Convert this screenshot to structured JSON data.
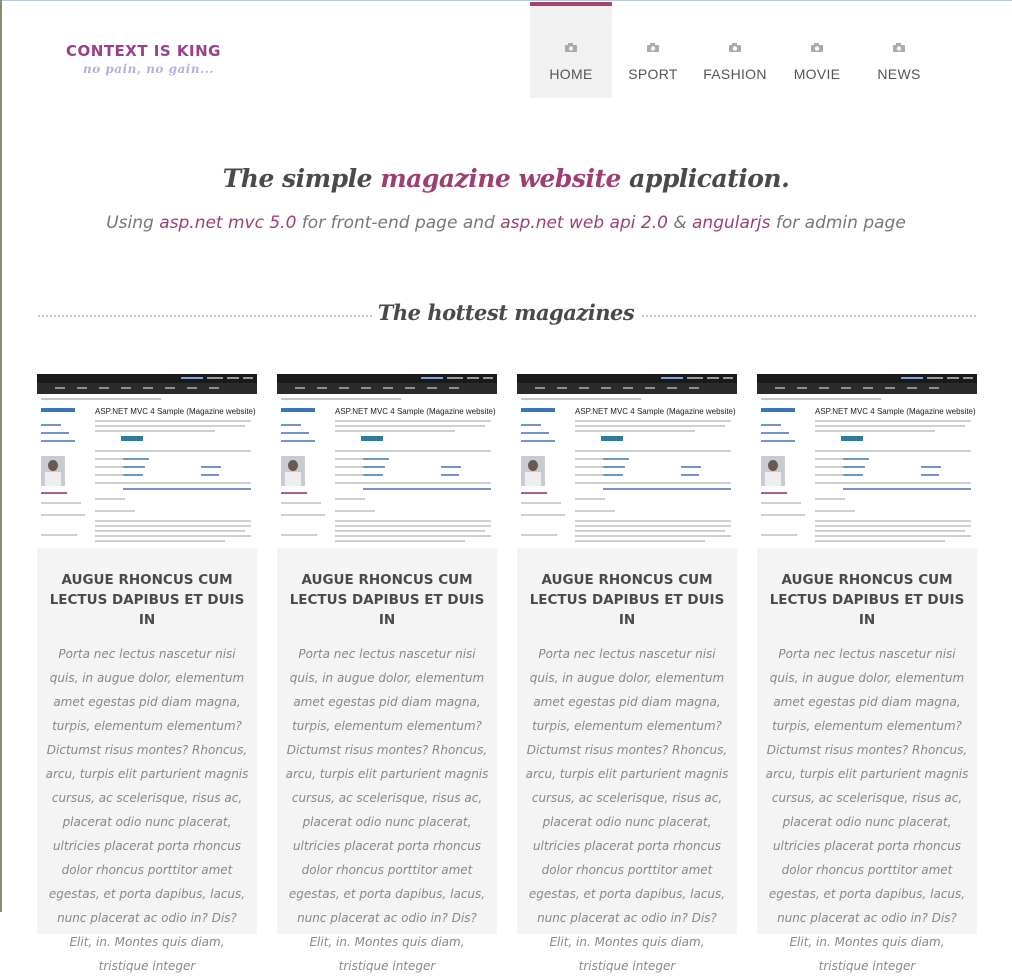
{
  "logo": {
    "title": "CONTEXT IS KING",
    "tagline": "no pain, no gain..."
  },
  "nav": {
    "items": [
      {
        "label": "HOME",
        "icon": "camera-icon",
        "active": true
      },
      {
        "label": "SPORT",
        "icon": "camera-icon",
        "active": false
      },
      {
        "label": "FASHION",
        "icon": "camera-icon",
        "active": false
      },
      {
        "label": "MOVIE",
        "icon": "camera-icon",
        "active": false
      },
      {
        "label": "NEWS",
        "icon": "camera-icon",
        "active": false
      }
    ]
  },
  "hero": {
    "title_pre": "The simple ",
    "title_accent": "magazine website",
    "title_post": " application.",
    "sub_1": "Using ",
    "sub_2": "asp.net mvc 5.0",
    "sub_3": " for front-end page and ",
    "sub_4": "asp.net web api 2.0",
    "sub_5": " & ",
    "sub_6": "angularjs",
    "sub_7": " for admin page"
  },
  "section": {
    "title": "The hottest magazines"
  },
  "cards": [
    {
      "thumb_title": "ASP.NET MVC 4 Sample (Magazine website)",
      "title": "AUGUE RHONCUS CUM LECTUS DAPIBUS ET DUIS IN",
      "text": "Porta nec lectus nascetur nisi quis, in augue dolor, elementum amet egestas pid diam magna, turpis, elementum elementum? Dictumst risus montes? Rhoncus, arcu, turpis elit parturient magnis cursus, ac scelerisque, risus ac, placerat odio nunc placerat, ultricies placerat porta rhoncus dolor rhoncus porttitor amet egestas, et porta dapibus, lacus, nunc placerat ac odio in? Dis? Elit, in. Montes quis diam, tristique integer"
    },
    {
      "thumb_title": "ASP.NET MVC 4 Sample (Magazine website)",
      "title": "AUGUE RHONCUS CUM LECTUS DAPIBUS ET DUIS IN",
      "text": "Porta nec lectus nascetur nisi quis, in augue dolor, elementum amet egestas pid diam magna, turpis, elementum elementum? Dictumst risus montes? Rhoncus, arcu, turpis elit parturient magnis cursus, ac scelerisque, risus ac, placerat odio nunc placerat, ultricies placerat porta rhoncus dolor rhoncus porttitor amet egestas, et porta dapibus, lacus, nunc placerat ac odio in? Dis? Elit, in. Montes quis diam, tristique integer"
    },
    {
      "thumb_title": "ASP.NET MVC 4 Sample (Magazine website)",
      "title": "AUGUE RHONCUS CUM LECTUS DAPIBUS ET DUIS IN",
      "text": "Porta nec lectus nascetur nisi quis, in augue dolor, elementum amet egestas pid diam magna, turpis, elementum elementum? Dictumst risus montes? Rhoncus, arcu, turpis elit parturient magnis cursus, ac scelerisque, risus ac, placerat odio nunc placerat, ultricies placerat porta rhoncus dolor rhoncus porttitor amet egestas, et porta dapibus, lacus, nunc placerat ac odio in? Dis? Elit, in. Montes quis diam, tristique integer"
    },
    {
      "thumb_title": "ASP.NET MVC 4 Sample (Magazine website)",
      "title": "AUGUE RHONCUS CUM LECTUS DAPIBUS ET DUIS IN",
      "text": "Porta nec lectus nascetur nisi quis, in augue dolor, elementum amet egestas pid diam magna, turpis, elementum elementum? Dictumst risus montes? Rhoncus, arcu, turpis elit parturient magnis cursus, ac scelerisque, risus ac, placerat odio nunc placerat, ultricies placerat porta rhoncus dolor rhoncus porttitor amet egestas, et porta dapibus, lacus, nunc placerat ac odio in? Dis? Elit, in. Montes quis diam, tristique integer"
    }
  ],
  "colors": {
    "accent": "#9e3f72",
    "logo": "#9b3f8b",
    "tagline": "#b9aee0",
    "card_bg": "#f4f4f4"
  }
}
